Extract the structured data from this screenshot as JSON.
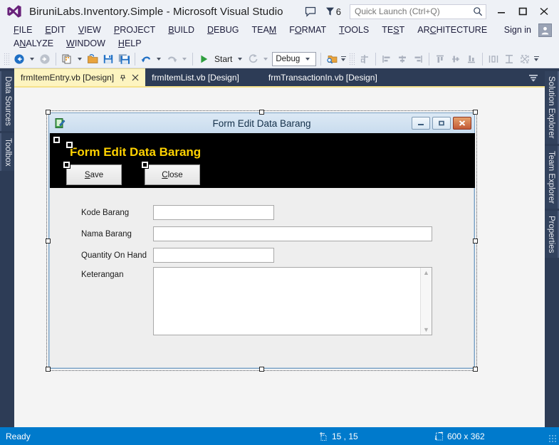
{
  "window": {
    "title": "BiruniLabs.Inventory.Simple - Microsoft Visual Studio",
    "logo_icon": "visual-studio-logo-icon",
    "feedback_icon": "feedback-balloon-icon",
    "notification_icon": "notification-funnel-icon",
    "notification_count": "6",
    "minimize_icon": "minimize-icon",
    "maximize_icon": "maximize-icon",
    "close_icon": "close-icon"
  },
  "quick_launch": {
    "placeholder": "Quick Launch (Ctrl+Q)",
    "value": "",
    "search_icon": "magnifier-icon"
  },
  "menu": {
    "items": [
      {
        "label": "FILE",
        "mnemonic": "F"
      },
      {
        "label": "EDIT",
        "mnemonic": "E"
      },
      {
        "label": "VIEW",
        "mnemonic": "V"
      },
      {
        "label": "PROJECT",
        "mnemonic": "P"
      },
      {
        "label": "BUILD",
        "mnemonic": "B"
      },
      {
        "label": "DEBUG",
        "mnemonic": "D"
      },
      {
        "label": "TEAM",
        "mnemonic": "M"
      },
      {
        "label": "FORMAT",
        "mnemonic": "O"
      },
      {
        "label": "TOOLS",
        "mnemonic": "T"
      },
      {
        "label": "TEST",
        "mnemonic": "S"
      },
      {
        "label": "ARCHITECTURE",
        "mnemonic": "C"
      },
      {
        "label": "ANALYZE",
        "mnemonic": "N"
      },
      {
        "label": "WINDOW",
        "mnemonic": "W"
      },
      {
        "label": "HELP",
        "mnemonic": "H"
      }
    ],
    "sign_in": "Sign in",
    "account_icon": "account-avatar-icon"
  },
  "toolbar": {
    "navigate_back_icon": "navigate-back-icon",
    "navigate_forward_icon": "navigate-forward-icon",
    "new_project_icon": "new-project-icon",
    "open_file_icon": "open-file-icon",
    "save_icon": "save-icon",
    "save_all_icon": "save-all-icon",
    "undo_icon": "undo-icon",
    "redo_icon": "redo-icon",
    "start_icon": "start-play-icon",
    "start_label": "Start",
    "restart_icon": "restart-icon",
    "config_label": "Debug",
    "find_icon": "find-in-files-icon",
    "align_to_grid_icon": "align-to-grid-icon",
    "align_lefts_icon": "align-lefts-icon",
    "align_centers_icon": "align-centers-icon",
    "align_rights_icon": "align-rights-icon",
    "align_tops_icon": "align-tops-icon",
    "align_middles_icon": "align-middles-icon",
    "align_bottoms_icon": "align-bottoms-icon",
    "make_same_width_icon": "make-same-width-icon",
    "make_same_height_icon": "make-same-height-icon",
    "make_same_size_icon": "make-same-size-icon",
    "overflow_icon": "toolbar-overflow-icon"
  },
  "left_dock": {
    "tabs": [
      {
        "label": "Data Sources"
      },
      {
        "label": "Toolbox"
      }
    ]
  },
  "right_dock": {
    "tabs": [
      {
        "label": "Solution Explorer"
      },
      {
        "label": "Team Explorer"
      },
      {
        "label": "Properties"
      }
    ]
  },
  "document_tabs": {
    "items": [
      {
        "label": "frmItemEntry.vb [Design]",
        "active": true,
        "pin_icon": "pin-icon",
        "close_icon": "tab-close-icon"
      },
      {
        "label": "frmItemList.vb [Design]",
        "active": false
      },
      {
        "label": "frmTransactionIn.vb [Design]",
        "active": false
      }
    ],
    "overflow_icon": "tab-list-overflow-icon"
  },
  "designer": {
    "form": {
      "icon": "form-designer-icon",
      "caption": "Form Edit Data Barang",
      "minimize_icon": "form-minimize-icon",
      "maximize_icon": "form-maximize-icon",
      "close_icon": "form-close-icon",
      "banner_text": "Form Edit Data Barang",
      "banner_color": "#000000",
      "banner_text_color": "#ffd200",
      "buttons": [
        {
          "label": "Save",
          "mnemonic": "S"
        },
        {
          "label": "Close",
          "mnemonic": "C"
        }
      ],
      "fields": [
        {
          "label": "Kode Barang",
          "value": "",
          "type": "textbox"
        },
        {
          "label": "Nama Barang",
          "value": "",
          "type": "textbox"
        },
        {
          "label": "Quantity On Hand",
          "value": "",
          "type": "textbox"
        },
        {
          "label": "Keterangan",
          "value": "",
          "type": "multiline"
        }
      ]
    }
  },
  "status_bar": {
    "message": "Ready",
    "position_icon": "designer-position-icon",
    "position": "15 , 15",
    "size_icon": "designer-size-icon",
    "size": "600 x 362"
  }
}
